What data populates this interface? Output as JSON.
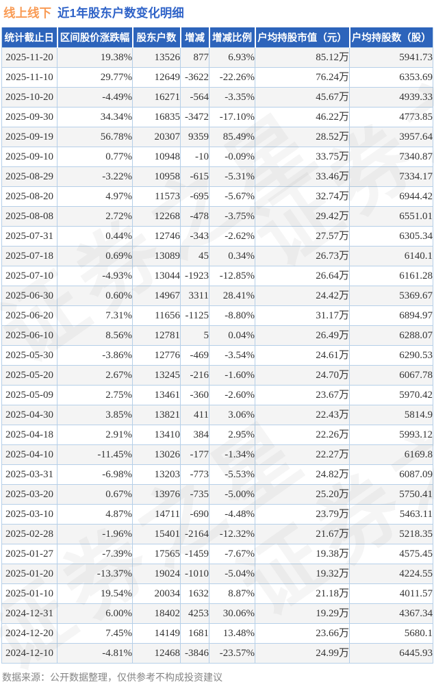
{
  "title": {
    "stock_name": "线上线下",
    "report_name": "近1年股东户数变化明细"
  },
  "chart_data": {
    "type": "table",
    "title": "线上线下 近1年股东户数变化明细",
    "columns": [
      "统计截止日",
      "区间股价涨跌幅",
      "股东户数",
      "增减",
      "增减比例",
      "户均持股市值（元）",
      "户均持股数（股）"
    ],
    "column_keys": [
      "date",
      "price-change",
      "holders",
      "delta",
      "delta-ratio",
      "avg-market-value",
      "avg-shares"
    ],
    "signed_columns": [
      1,
      3,
      4
    ],
    "rows": [
      [
        "2025-11-20",
        "19.38%",
        "13526",
        "877",
        "6.93%",
        "85.12万",
        "5941.73"
      ],
      [
        "2025-11-10",
        "29.77%",
        "12649",
        "-3622",
        "-22.26%",
        "76.24万",
        "6353.69"
      ],
      [
        "2025-10-20",
        "-4.49%",
        "16271",
        "-564",
        "-3.35%",
        "45.67万",
        "4939.33"
      ],
      [
        "2025-09-30",
        "34.34%",
        "16835",
        "-3472",
        "-17.10%",
        "46.22万",
        "4773.85"
      ],
      [
        "2025-09-19",
        "56.78%",
        "20307",
        "9359",
        "85.49%",
        "28.52万",
        "3957.64"
      ],
      [
        "2025-09-10",
        "0.77%",
        "10948",
        "-10",
        "-0.09%",
        "33.75万",
        "7340.87"
      ],
      [
        "2025-08-29",
        "-3.22%",
        "10958",
        "-615",
        "-5.31%",
        "33.46万",
        "7334.17"
      ],
      [
        "2025-08-20",
        "4.97%",
        "11573",
        "-695",
        "-5.67%",
        "32.74万",
        "6944.42"
      ],
      [
        "2025-08-08",
        "2.72%",
        "12268",
        "-478",
        "-3.75%",
        "29.42万",
        "6551.01"
      ],
      [
        "2025-07-31",
        "0.44%",
        "12746",
        "-343",
        "-2.62%",
        "27.57万",
        "6305.34"
      ],
      [
        "2025-07-18",
        "0.69%",
        "13089",
        "45",
        "0.34%",
        "26.73万",
        "6140.1"
      ],
      [
        "2025-07-10",
        "-4.93%",
        "13044",
        "-1923",
        "-12.85%",
        "26.64万",
        "6161.28"
      ],
      [
        "2025-06-30",
        "0.60%",
        "14967",
        "3311",
        "28.41%",
        "24.42万",
        "5369.67"
      ],
      [
        "2025-06-20",
        "7.31%",
        "11656",
        "-1125",
        "-8.80%",
        "31.17万",
        "6894.97"
      ],
      [
        "2025-06-10",
        "8.56%",
        "12781",
        "5",
        "0.04%",
        "26.49万",
        "6288.07"
      ],
      [
        "2025-05-30",
        "-3.86%",
        "12776",
        "-469",
        "-3.54%",
        "24.61万",
        "6290.53"
      ],
      [
        "2025-05-20",
        "2.67%",
        "13245",
        "-216",
        "-1.60%",
        "24.70万",
        "6067.78"
      ],
      [
        "2025-05-09",
        "2.75%",
        "13461",
        "-360",
        "-2.60%",
        "23.67万",
        "5970.42"
      ],
      [
        "2025-04-30",
        "3.85%",
        "13821",
        "411",
        "3.06%",
        "22.43万",
        "5814.9"
      ],
      [
        "2025-04-18",
        "2.91%",
        "13410",
        "384",
        "2.95%",
        "22.26万",
        "5993.12"
      ],
      [
        "2025-04-10",
        "-11.45%",
        "13026",
        "-177",
        "-1.34%",
        "22.27万",
        "6169.8"
      ],
      [
        "2025-03-31",
        "-6.98%",
        "13203",
        "-773",
        "-5.53%",
        "24.82万",
        "6087.09"
      ],
      [
        "2025-03-20",
        "0.67%",
        "13976",
        "-735",
        "-5.00%",
        "25.20万",
        "5750.41"
      ],
      [
        "2025-03-10",
        "4.87%",
        "14711",
        "-690",
        "-4.48%",
        "23.79万",
        "5463.11"
      ],
      [
        "2025-02-28",
        "-1.96%",
        "15401",
        "-2164",
        "-12.32%",
        "21.67万",
        "5218.35"
      ],
      [
        "2025-01-27",
        "-7.39%",
        "17565",
        "-1459",
        "-7.67%",
        "19.38万",
        "4575.45"
      ],
      [
        "2025-01-20",
        "-13.37%",
        "19024",
        "-1010",
        "-5.04%",
        "19.32万",
        "4224.55"
      ],
      [
        "2025-01-10",
        "19.54%",
        "20034",
        "1632",
        "8.87%",
        "21.18万",
        "4011.57"
      ],
      [
        "2024-12-31",
        "6.00%",
        "18402",
        "4253",
        "30.06%",
        "19.29万",
        "4367.34"
      ],
      [
        "2024-12-20",
        "7.45%",
        "14149",
        "1681",
        "13.48%",
        "23.66万",
        "5680.1"
      ],
      [
        "2024-12-10",
        "-4.81%",
        "12468",
        "-3846",
        "-23.57%",
        "24.99万",
        "6445.93"
      ]
    ]
  },
  "footer": {
    "text": "数据来源：公开数据整理，仅供参考不构成投资建议"
  },
  "watermark": "证券之星",
  "colors": {
    "positive_red": "#fb2b2b",
    "negative_green": "#149e4c",
    "header_bg": "#2d64bb",
    "title_orange": "#f99b55",
    "title_blue": "#2f63c8",
    "row_stripe": "#f4f4f4",
    "table_border": "#b5cfe8"
  }
}
